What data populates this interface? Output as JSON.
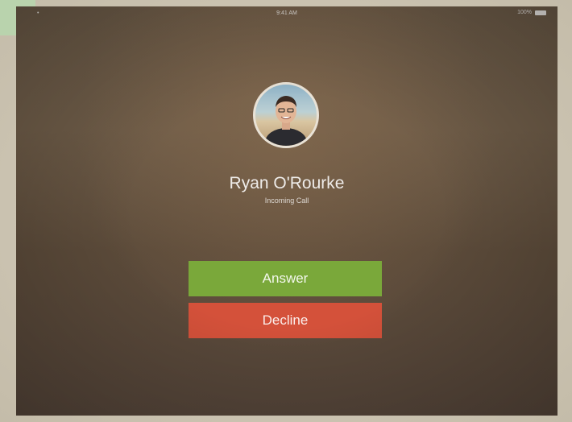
{
  "status_bar": {
    "carrier": "•",
    "time": "9:41 AM",
    "battery": "100%"
  },
  "call": {
    "caller_name": "Ryan O'Rourke",
    "status": "Incoming Call"
  },
  "actions": {
    "answer_label": "Answer",
    "decline_label": "Decline"
  },
  "colors": {
    "answer": "#7aa83a",
    "decline": "#d4513a"
  }
}
